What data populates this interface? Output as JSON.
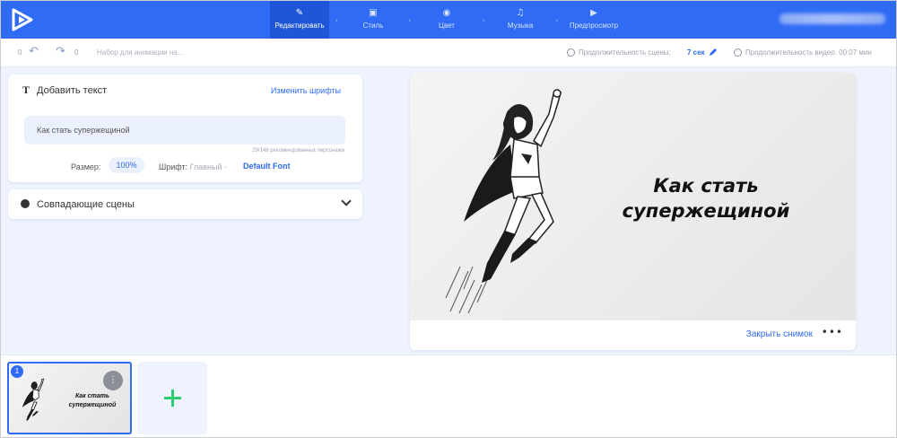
{
  "nav": {
    "steps": [
      {
        "label": "Редактировать",
        "icon": "✎"
      },
      {
        "label": "Стиль",
        "icon": "▣"
      },
      {
        "label": "Цвет",
        "icon": "◉"
      },
      {
        "label": "Музыка",
        "icon": "♫"
      },
      {
        "label": "Предпросмотр",
        "icon": "▶"
      }
    ],
    "step_separator": "›",
    "active_step": "Редактировать",
    "accent_color": "#2f6bf5"
  },
  "toolbar": {
    "undo_count": "0",
    "redo_count": "0",
    "undo_icon": "↶",
    "redo_icon": "↷",
    "project_name": "Набор для анимации на...",
    "scene_duration_label": "Продолжительность сцены:",
    "scene_duration_value": "7 сек",
    "video_duration_label": "Продолжительность видео: 00:07 мин"
  },
  "text_panel": {
    "title": "Добавить текст",
    "change_fonts": "Изменить шрифты",
    "input_value": "Как стать супержещиной",
    "char_hint": "29/148 рекомендованных персонажи",
    "size_label": "Размер:",
    "size_value": "100%",
    "font_label": "Шрифт:",
    "font_main": "Главный -",
    "font_value": "Default Font"
  },
  "matching_scenes": {
    "title": "Совпадающие сцены"
  },
  "preview": {
    "text_line1": "Как стать",
    "text_line2": "супержещиной",
    "close_snapshot": "Закрыть снимок",
    "more": "•••"
  },
  "timeline": {
    "scenes": [
      {
        "number": "1",
        "text_line1": "Как стать",
        "text_line2": "супержещиной"
      }
    ],
    "menu_icon": "⋮"
  }
}
